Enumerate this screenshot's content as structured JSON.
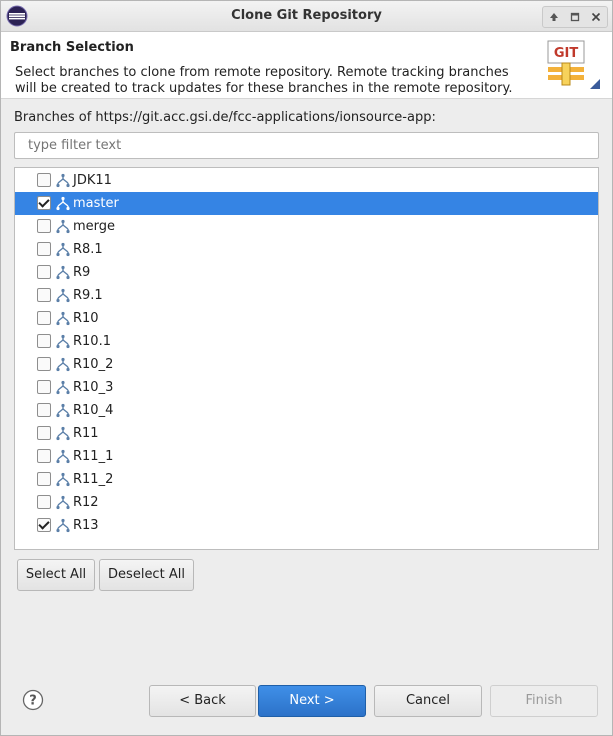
{
  "window": {
    "title": "Clone Git Repository"
  },
  "header": {
    "title": "Branch Selection",
    "description": "Select branches to clone from remote repository. Remote tracking branches will be created to track updates for these branches in the remote repository.",
    "logo_text": "GIT"
  },
  "branches_label": "Branches of https://git.acc.gsi.de/fcc-applications/ionsource-app:",
  "filter": {
    "placeholder": "type filter text",
    "value": ""
  },
  "branches": [
    {
      "name": "JDK11",
      "checked": false,
      "selected": false
    },
    {
      "name": "master",
      "checked": true,
      "selected": true
    },
    {
      "name": "merge",
      "checked": false,
      "selected": false
    },
    {
      "name": "R8.1",
      "checked": false,
      "selected": false
    },
    {
      "name": "R9",
      "checked": false,
      "selected": false
    },
    {
      "name": "R9.1",
      "checked": false,
      "selected": false
    },
    {
      "name": "R10",
      "checked": false,
      "selected": false
    },
    {
      "name": "R10.1",
      "checked": false,
      "selected": false
    },
    {
      "name": "R10_2",
      "checked": false,
      "selected": false
    },
    {
      "name": "R10_3",
      "checked": false,
      "selected": false
    },
    {
      "name": "R10_4",
      "checked": false,
      "selected": false
    },
    {
      "name": "R11",
      "checked": false,
      "selected": false
    },
    {
      "name": "R11_1",
      "checked": false,
      "selected": false
    },
    {
      "name": "R11_2",
      "checked": false,
      "selected": false
    },
    {
      "name": "R12",
      "checked": false,
      "selected": false
    },
    {
      "name": "R13",
      "checked": true,
      "selected": false
    }
  ],
  "buttons": {
    "select_all": "Select All",
    "deselect_all": "Deselect All",
    "back": "< Back",
    "next": "Next >",
    "cancel": "Cancel",
    "finish": "Finish"
  },
  "help_icon": "?",
  "colors": {
    "selection": "#3584e4",
    "primary_button": "#2c72c8"
  }
}
